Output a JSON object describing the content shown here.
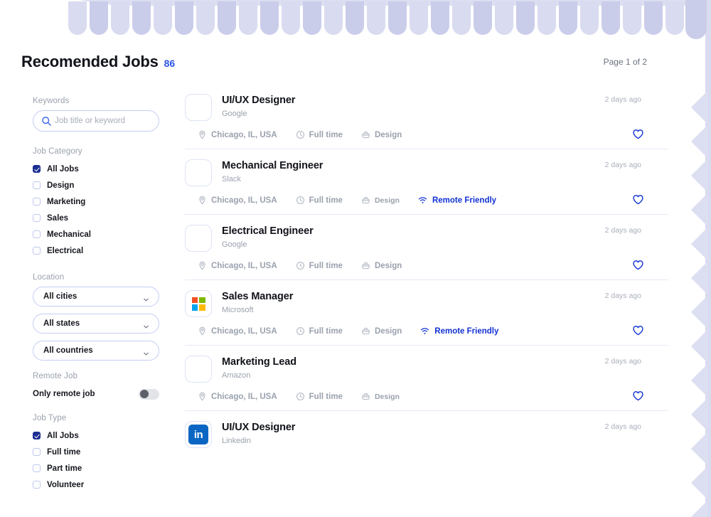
{
  "header": {
    "title": "Recomended Jobs",
    "count": "86",
    "pager": "Page 1 of 2"
  },
  "sidebar": {
    "keywords_label": "Keywords",
    "search_placeholder": "Job title or keyword",
    "search_value": "",
    "search_icon": "search-icon",
    "job_category_label": "Job Category",
    "job_category": [
      {
        "label": "All Jobs",
        "checked": true
      },
      {
        "label": "Design",
        "checked": false
      },
      {
        "label": "Marketing",
        "checked": false
      },
      {
        "label": "Sales",
        "checked": false
      },
      {
        "label": "Mechanical",
        "checked": false
      },
      {
        "label": "Electrical",
        "checked": false
      }
    ],
    "location_label": "Location",
    "location_selects": [
      {
        "value": "All cities"
      },
      {
        "value": "All states"
      },
      {
        "value": "All countries"
      }
    ],
    "remote_label": "Remote Job",
    "remote_toggle_label": "Only remote job",
    "remote_toggle_on": false,
    "job_type_label": "Job Type",
    "job_type": [
      {
        "label": "All Jobs",
        "checked": true
      },
      {
        "label": "Full time",
        "checked": false
      },
      {
        "label": "Part time",
        "checked": false
      },
      {
        "label": "Volunteer",
        "checked": false
      }
    ]
  },
  "jobs": [
    {
      "title": "UI/UX Designer",
      "company": "Google",
      "date": "2 days ago",
      "logo": "blank-logo",
      "location": "Chicago, IL, USA",
      "employment": "Full time",
      "category": "Design",
      "remote": "",
      "saved": false
    },
    {
      "title": "Mechanical Engineer",
      "company": "Slack",
      "date": "2 days ago",
      "logo": "blank-logo",
      "location": "Chicago, IL, USA",
      "employment": "Full time",
      "category": "Design",
      "remote": "Remote Friendly",
      "saved": false
    },
    {
      "title": "Electrical Engineer",
      "company": "Google",
      "date": "2 days ago",
      "logo": "blank-logo",
      "location": "Chicago, IL, USA",
      "employment": "Full time",
      "category": "Design",
      "remote": "",
      "saved": false
    },
    {
      "title": "Sales Manager",
      "company": "Microsoft",
      "date": "2 days ago",
      "logo": "microsoft-logo",
      "location": "Chicago, IL, USA",
      "employment": "Full time",
      "category": "Design",
      "remote": "Remote Friendly",
      "saved": false
    },
    {
      "title": "Marketing Lead",
      "company": "Amazon",
      "date": "2 days ago",
      "logo": "blank-logo",
      "location": "Chicago, IL, USA",
      "employment": "Full time",
      "category": "Design",
      "remote": "",
      "saved": false
    },
    {
      "title": "UI/UX Designer",
      "company": "Linkedin",
      "date": "2 days ago",
      "logo": "linkedin-logo",
      "location": "",
      "employment": "",
      "category": "",
      "remote": "",
      "saved": false
    }
  ],
  "icons": {
    "location": "map-pin-icon",
    "employment": "clock-icon",
    "category": "briefcase-icon",
    "remote": "wifi-icon",
    "save": "heart-icon",
    "dropdown": "chevron-down-icon"
  },
  "colors": {
    "accent_blue": "#2a55e5",
    "remote_blue": "#1232d4",
    "checkbox_navy": "#1c2f92",
    "border_periwinkle": "#c3cdf5",
    "deco_lavender": "#d6d8ef",
    "muted_text": "#9aa1ad",
    "title_dark": "#11131a",
    "linkedin_blue": "#0a66c2"
  }
}
